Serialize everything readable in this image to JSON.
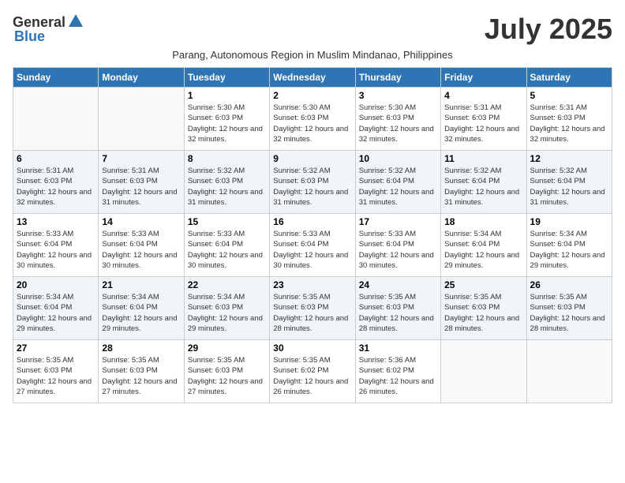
{
  "logo": {
    "general": "General",
    "blue": "Blue"
  },
  "header": {
    "month_year": "July 2025",
    "subtitle": "Parang, Autonomous Region in Muslim Mindanao, Philippines"
  },
  "weekdays": [
    "Sunday",
    "Monday",
    "Tuesday",
    "Wednesday",
    "Thursday",
    "Friday",
    "Saturday"
  ],
  "weeks": [
    [
      {
        "day": "",
        "info": ""
      },
      {
        "day": "",
        "info": ""
      },
      {
        "day": "1",
        "info": "Sunrise: 5:30 AM\nSunset: 6:03 PM\nDaylight: 12 hours and 32 minutes."
      },
      {
        "day": "2",
        "info": "Sunrise: 5:30 AM\nSunset: 6:03 PM\nDaylight: 12 hours and 32 minutes."
      },
      {
        "day": "3",
        "info": "Sunrise: 5:30 AM\nSunset: 6:03 PM\nDaylight: 12 hours and 32 minutes."
      },
      {
        "day": "4",
        "info": "Sunrise: 5:31 AM\nSunset: 6:03 PM\nDaylight: 12 hours and 32 minutes."
      },
      {
        "day": "5",
        "info": "Sunrise: 5:31 AM\nSunset: 6:03 PM\nDaylight: 12 hours and 32 minutes."
      }
    ],
    [
      {
        "day": "6",
        "info": "Sunrise: 5:31 AM\nSunset: 6:03 PM\nDaylight: 12 hours and 32 minutes."
      },
      {
        "day": "7",
        "info": "Sunrise: 5:31 AM\nSunset: 6:03 PM\nDaylight: 12 hours and 31 minutes."
      },
      {
        "day": "8",
        "info": "Sunrise: 5:32 AM\nSunset: 6:03 PM\nDaylight: 12 hours and 31 minutes."
      },
      {
        "day": "9",
        "info": "Sunrise: 5:32 AM\nSunset: 6:03 PM\nDaylight: 12 hours and 31 minutes."
      },
      {
        "day": "10",
        "info": "Sunrise: 5:32 AM\nSunset: 6:04 PM\nDaylight: 12 hours and 31 minutes."
      },
      {
        "day": "11",
        "info": "Sunrise: 5:32 AM\nSunset: 6:04 PM\nDaylight: 12 hours and 31 minutes."
      },
      {
        "day": "12",
        "info": "Sunrise: 5:32 AM\nSunset: 6:04 PM\nDaylight: 12 hours and 31 minutes."
      }
    ],
    [
      {
        "day": "13",
        "info": "Sunrise: 5:33 AM\nSunset: 6:04 PM\nDaylight: 12 hours and 30 minutes."
      },
      {
        "day": "14",
        "info": "Sunrise: 5:33 AM\nSunset: 6:04 PM\nDaylight: 12 hours and 30 minutes."
      },
      {
        "day": "15",
        "info": "Sunrise: 5:33 AM\nSunset: 6:04 PM\nDaylight: 12 hours and 30 minutes."
      },
      {
        "day": "16",
        "info": "Sunrise: 5:33 AM\nSunset: 6:04 PM\nDaylight: 12 hours and 30 minutes."
      },
      {
        "day": "17",
        "info": "Sunrise: 5:33 AM\nSunset: 6:04 PM\nDaylight: 12 hours and 30 minutes."
      },
      {
        "day": "18",
        "info": "Sunrise: 5:34 AM\nSunset: 6:04 PM\nDaylight: 12 hours and 29 minutes."
      },
      {
        "day": "19",
        "info": "Sunrise: 5:34 AM\nSunset: 6:04 PM\nDaylight: 12 hours and 29 minutes."
      }
    ],
    [
      {
        "day": "20",
        "info": "Sunrise: 5:34 AM\nSunset: 6:04 PM\nDaylight: 12 hours and 29 minutes."
      },
      {
        "day": "21",
        "info": "Sunrise: 5:34 AM\nSunset: 6:04 PM\nDaylight: 12 hours and 29 minutes."
      },
      {
        "day": "22",
        "info": "Sunrise: 5:34 AM\nSunset: 6:03 PM\nDaylight: 12 hours and 29 minutes."
      },
      {
        "day": "23",
        "info": "Sunrise: 5:35 AM\nSunset: 6:03 PM\nDaylight: 12 hours and 28 minutes."
      },
      {
        "day": "24",
        "info": "Sunrise: 5:35 AM\nSunset: 6:03 PM\nDaylight: 12 hours and 28 minutes."
      },
      {
        "day": "25",
        "info": "Sunrise: 5:35 AM\nSunset: 6:03 PM\nDaylight: 12 hours and 28 minutes."
      },
      {
        "day": "26",
        "info": "Sunrise: 5:35 AM\nSunset: 6:03 PM\nDaylight: 12 hours and 28 minutes."
      }
    ],
    [
      {
        "day": "27",
        "info": "Sunrise: 5:35 AM\nSunset: 6:03 PM\nDaylight: 12 hours and 27 minutes."
      },
      {
        "day": "28",
        "info": "Sunrise: 5:35 AM\nSunset: 6:03 PM\nDaylight: 12 hours and 27 minutes."
      },
      {
        "day": "29",
        "info": "Sunrise: 5:35 AM\nSunset: 6:03 PM\nDaylight: 12 hours and 27 minutes."
      },
      {
        "day": "30",
        "info": "Sunrise: 5:35 AM\nSunset: 6:02 PM\nDaylight: 12 hours and 26 minutes."
      },
      {
        "day": "31",
        "info": "Sunrise: 5:36 AM\nSunset: 6:02 PM\nDaylight: 12 hours and 26 minutes."
      },
      {
        "day": "",
        "info": ""
      },
      {
        "day": "",
        "info": ""
      }
    ]
  ]
}
